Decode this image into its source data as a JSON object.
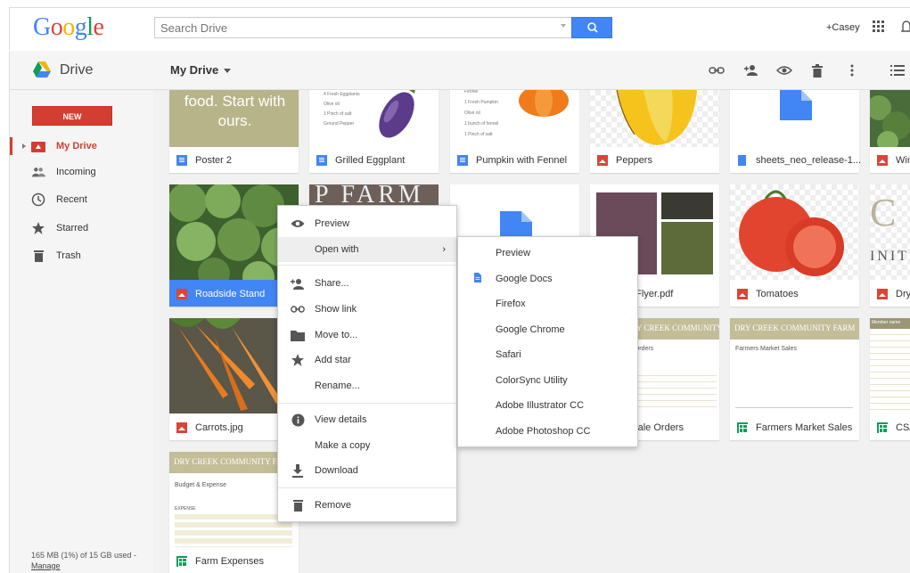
{
  "header": {
    "search_placeholder": "Search Drive",
    "user": "+Casey"
  },
  "drivebar": {
    "app_title": "Drive",
    "location": "My Drive"
  },
  "sidebar": {
    "new_label": "NEW",
    "items": [
      {
        "label": "My Drive"
      },
      {
        "label": "Incoming"
      },
      {
        "label": "Recent"
      },
      {
        "label": "Starred"
      },
      {
        "label": "Trash"
      }
    ],
    "storage": "165 MB (1%) of 15 GB used -",
    "manage": "Manage"
  },
  "thumbs": {
    "poster_text": "food. Start with ours.",
    "recipe_lines": [
      "4 Fresh Eggplants",
      "Olive oil",
      "1 Pinch of salt",
      "Ground Pepper"
    ],
    "pumpkin_lines": [
      "Fennel",
      "1 Fresh Pumpkin",
      "Olive oil",
      "1 bunch of fennel",
      "1 Pinch of salt"
    ],
    "farm_text": "P FARM",
    "flyer_text": "DRY CREEK COMMUNITY FARM",
    "wholesale_heading": "et Orders",
    "sales_heading": "Farmers Market Sales",
    "budget_heading": "Budget & Expense",
    "expense_label": "EXPENSE",
    "grid_label": "Member name",
    "letters": "C",
    "letters2": "INIT"
  },
  "files": [
    {
      "name": "Poster 2",
      "type": "doc"
    },
    {
      "name": "Grilled Eggplant",
      "type": "doc"
    },
    {
      "name": "Pumpkin with Fennel",
      "type": "doc"
    },
    {
      "name": "Peppers",
      "type": "img"
    },
    {
      "name": "sheets_neo_release-1...",
      "type": "file"
    },
    {
      "name": "Win",
      "type": "img"
    },
    {
      "name": "Roadside Stand",
      "type": "img"
    },
    {
      "name": "etFlyer.pdf",
      "type": "pdf"
    },
    {
      "name": "Tomatoes",
      "type": "img"
    },
    {
      "name": "Dry",
      "type": "img"
    },
    {
      "name": "Carrots.jpg",
      "type": "img"
    },
    {
      "name": "esale Orders",
      "type": "sheet"
    },
    {
      "name": "Farmers Market Sales",
      "type": "sheet"
    },
    {
      "name": "CSA",
      "type": "sheet"
    },
    {
      "name": "Farm Expenses",
      "type": "sheet"
    }
  ],
  "context_menu": {
    "items": [
      {
        "label": "Preview",
        "icon": "eye-icon"
      },
      {
        "label": "Open with",
        "icon": "none"
      },
      {
        "label": "Share...",
        "icon": "add-person-icon"
      },
      {
        "label": "Show link",
        "icon": "link-icon"
      },
      {
        "label": "Move to...",
        "icon": "folder-icon"
      },
      {
        "label": "Add star",
        "icon": "star-icon"
      },
      {
        "label": "Rename...",
        "icon": "none"
      },
      {
        "label": "View details",
        "icon": "info-icon"
      },
      {
        "label": "Make a copy",
        "icon": "none"
      },
      {
        "label": "Download",
        "icon": "download-icon"
      },
      {
        "label": "Remove",
        "icon": "trash-icon"
      }
    ],
    "submenu_arrow": "›"
  },
  "open_with": {
    "items": [
      {
        "label": "Preview"
      },
      {
        "label": "Google Docs"
      },
      {
        "label": "Firefox"
      },
      {
        "label": "Google Chrome"
      },
      {
        "label": "Safari"
      },
      {
        "label": "ColorSync Utility"
      },
      {
        "label": "Adobe Illustrator CC"
      },
      {
        "label": "Adobe Photoshop CC"
      }
    ]
  },
  "colors": {
    "accent_red": "#d23f31",
    "search_blue": "#4285f4",
    "sheet_green": "#0f9d58"
  }
}
